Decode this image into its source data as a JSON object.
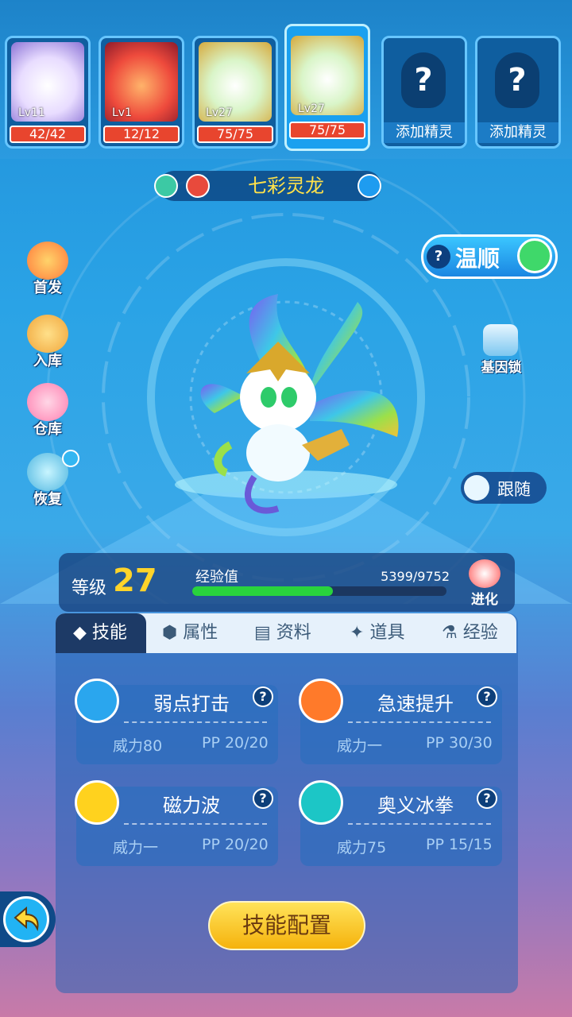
{
  "team": {
    "slots": [
      {
        "level": "Lv11",
        "hp": "42/42",
        "color": "#f3eaff"
      },
      {
        "level": "Lv1",
        "hp": "12/12",
        "color": "#ee4a3c"
      },
      {
        "level": "Lv27",
        "hp": "75/75",
        "color": "#f7f4e6"
      },
      {
        "level": "Lv27",
        "hp": "75/75",
        "color": "#f7f4e6"
      }
    ],
    "empty_label": "添加精灵",
    "empty_q": "?"
  },
  "pet": {
    "name": "七彩灵龙"
  },
  "side_menu": {
    "first": "首发",
    "store": "入库",
    "warehouse": "仓库",
    "restore": "恢复"
  },
  "temperament": {
    "q": "?",
    "label": "温顺"
  },
  "gene_lock": {
    "label": "基因锁"
  },
  "follow": {
    "label": "跟随"
  },
  "level_panel": {
    "level_label": "等级",
    "level_value": "27",
    "exp_label": "经验值",
    "exp_value": "5399/9752",
    "exp_fraction": 0.554,
    "evolve_label": "进化"
  },
  "tabs": [
    "技能",
    "属性",
    "资料",
    "道具",
    "经验"
  ],
  "skills": [
    {
      "name": "弱点打击",
      "power": "威力80",
      "pp": "PP 20/20",
      "icon_color": "#2aa6ee"
    },
    {
      "name": "急速提升",
      "power": "威力一",
      "pp": "PP 30/30",
      "icon_color": "#ff7a2a"
    },
    {
      "name": "磁力波",
      "power": "威力一",
      "pp": "PP 20/20",
      "icon_color": "#ffd21e"
    },
    {
      "name": "奥义冰拳",
      "power": "威力75",
      "pp": "PP 15/15",
      "icon_color": "#1cc6c6"
    }
  ],
  "config_button": "技能配置"
}
